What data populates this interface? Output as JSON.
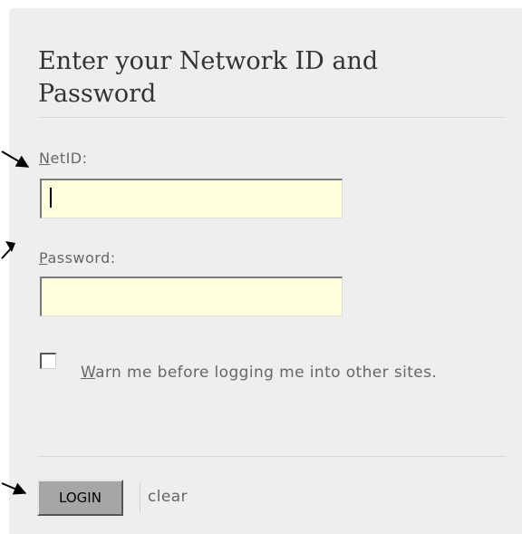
{
  "login_form": {
    "heading": "Enter your Network ID and Password",
    "netid": {
      "label_first": "N",
      "label_rest": "etID:",
      "value": ""
    },
    "password": {
      "label_first": "P",
      "label_rest": "assword:",
      "value": ""
    },
    "warn": {
      "label_first": "W",
      "label_rest": "arn me before logging me into other sites.",
      "checked": false
    },
    "login_label": "LOGIN",
    "clear_label": "clear"
  },
  "colors": {
    "panel_background": "#eeeeee",
    "input_background": "#ffffdd",
    "button_background": "#a6a6a6",
    "text_gray": "#666666",
    "heading_text": "#333333"
  }
}
